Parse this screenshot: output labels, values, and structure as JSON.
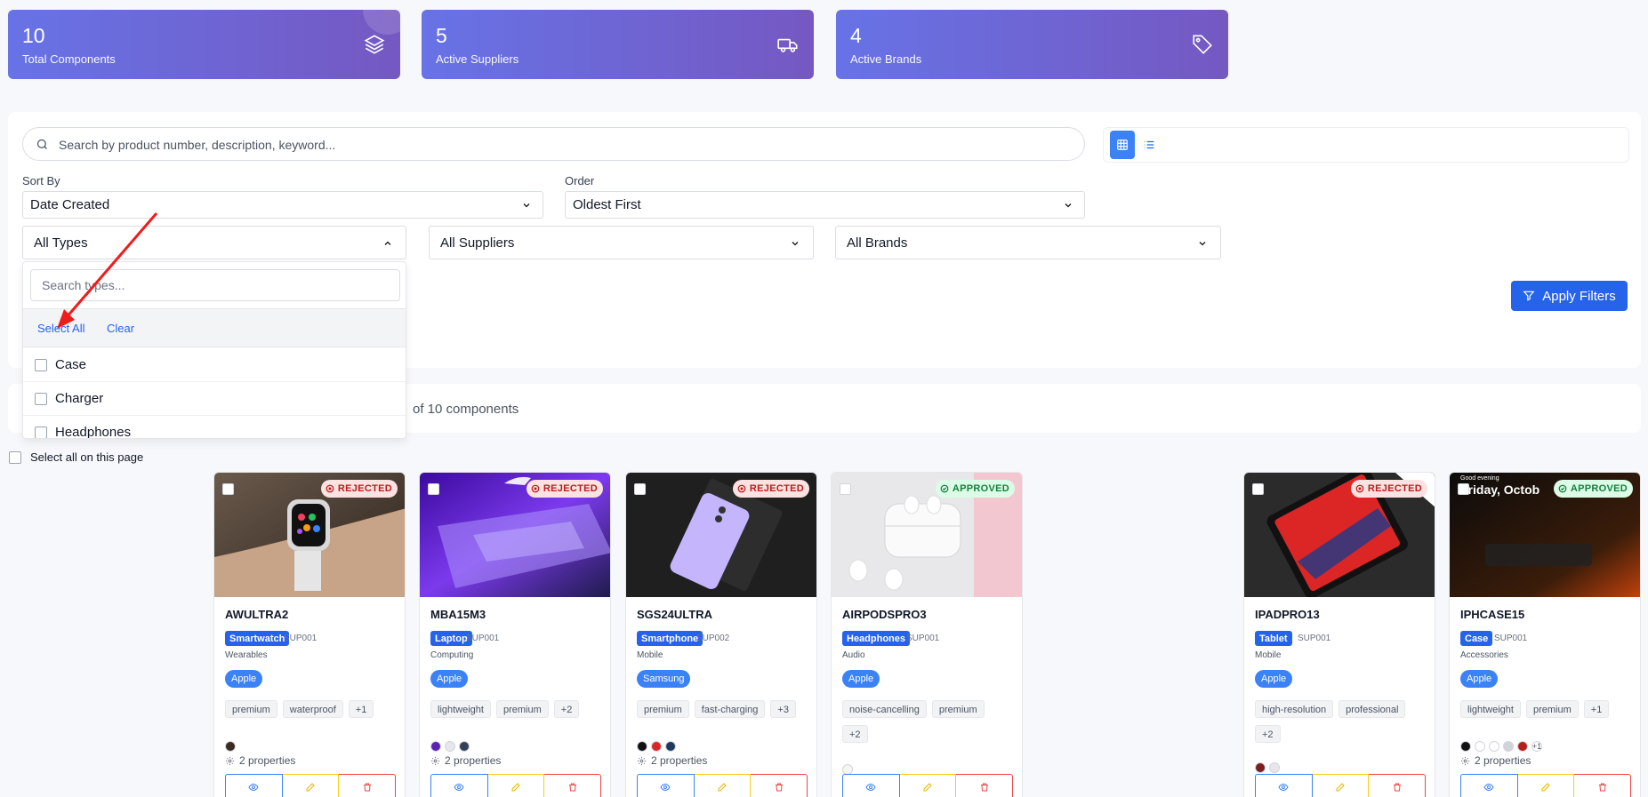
{
  "stats": [
    {
      "value": "10",
      "label": "Total Components",
      "icon": "layers-icon"
    },
    {
      "value": "5",
      "label": "Active Suppliers",
      "icon": "truck-icon"
    },
    {
      "value": "4",
      "label": "Active Brands",
      "icon": "tag-icon"
    }
  ],
  "search": {
    "placeholder": "Search by product number, description, keyword..."
  },
  "sort": {
    "label": "Sort By",
    "value": "Date Created"
  },
  "order": {
    "label": "Order",
    "value": "Oldest First"
  },
  "filters": {
    "types": "All Types",
    "suppliers": "All Suppliers",
    "brands": "All Brands",
    "apply": "Apply Filters"
  },
  "type_menu": {
    "search_placeholder": "Search types...",
    "select_all": "Select All",
    "clear": "Clear",
    "options": [
      "Case",
      "Charger",
      "Headphones"
    ]
  },
  "results": {
    "text": "of 10 components"
  },
  "select_all_page": "Select all on this page",
  "colors": {
    "accent": "#2563eb",
    "rejected": "#b91c1c",
    "approved": "#15803d"
  },
  "cards": [
    {
      "code": "AWULTRA2",
      "type": "Smartwatch",
      "supplier": "SUP001",
      "category": "Wearables",
      "brand": "Apple",
      "status": "REJECTED",
      "tags": [
        "premium",
        "waterproof",
        "+1"
      ],
      "properties": "2 properties"
    },
    {
      "code": "MBA15M3",
      "type": "Laptop",
      "supplier": "SUP001",
      "category": "Computing",
      "brand": "Apple",
      "status": "REJECTED",
      "tags": [
        "lightweight",
        "premium",
        "+2"
      ],
      "properties": "2 properties"
    },
    {
      "code": "SGS24ULTRA",
      "type": "Smartphone",
      "supplier": "SUP002",
      "category": "Mobile",
      "brand": "Samsung",
      "status": "REJECTED",
      "tags": [
        "premium",
        "fast-charging",
        "+3"
      ],
      "properties": "2 properties"
    },
    {
      "code": "AIRPODSPRO3",
      "type": "Headphones",
      "supplier": "SUP001",
      "category": "Audio",
      "brand": "Apple",
      "status": "APPROVED",
      "tags": [
        "noise-cancelling",
        "premium",
        "+2"
      ],
      "properties": ""
    },
    {
      "code": "IPADPRO13",
      "type": "Tablet",
      "supplier": "SUP001",
      "category": "Mobile",
      "brand": "Apple",
      "status": "REJECTED",
      "tags": [
        "high-resolution",
        "professional",
        "+2"
      ],
      "properties": ""
    },
    {
      "code": "IPHCASE15",
      "type": "Case",
      "supplier": "SUP001",
      "category": "Accessories",
      "brand": "Apple",
      "status": "APPROVED",
      "tags": [
        "lightweight",
        "premium",
        "+1"
      ],
      "properties": "2 properties",
      "swatch_more": "+1",
      "screen_text": "Friday, Octob",
      "screen_greeting": "Good evening"
    }
  ]
}
